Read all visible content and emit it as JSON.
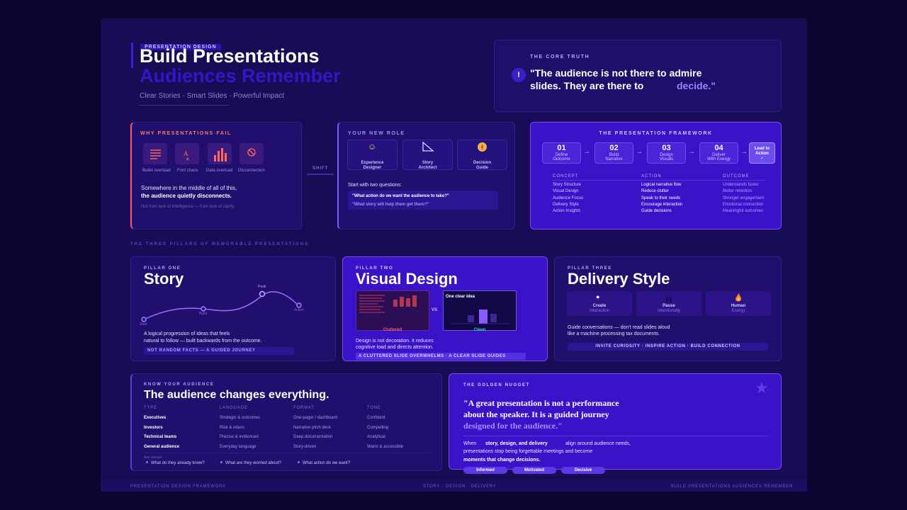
{
  "header": {
    "eyebrow": "PRESENTATION DESIGN",
    "title": "Build Presentations",
    "title_2": "Audiences Remember",
    "subtitle": "Clear Stories · Smart Slides · Powerful Impact"
  },
  "core_truth": {
    "label": "THE CORE TRUTH",
    "icon": "exclamation-icon",
    "quote_1": "\"The audience is not there to admire",
    "quote_2": "slides. They are there to",
    "quote_highlight": "decide.\""
  },
  "why_fail": {
    "label": "WHY PRESENTATIONS FAIL",
    "items": [
      {
        "icon": "bullet-list-icon",
        "label": "Bullet overload"
      },
      {
        "icon": "font-chaos-icon",
        "label": "Font chaos"
      },
      {
        "icon": "bar-chart-icon",
        "label": "Data overload"
      },
      {
        "icon": "ban-icon",
        "label": "Disconnection"
      }
    ],
    "text_1": "Somewhere in the middle of all of this,",
    "text_2": "the audience quietly disconnects.",
    "footnote": "Not from lack of intelligence — from lack of clarity."
  },
  "shift": {
    "label": "SHIFT"
  },
  "new_role": {
    "label": "YOUR NEW ROLE",
    "roles": [
      {
        "icon": "theater-masks-icon",
        "line1": "Experience",
        "line2": "Designer"
      },
      {
        "icon": "set-square-icon",
        "line1": "Story",
        "line2": "Architect"
      },
      {
        "icon": "compass-icon",
        "line1": "Decision",
        "line2": "Guide"
      }
    ],
    "prompt": "Start with two questions:",
    "q1": "\"What action do we want the audience to take?\"",
    "q2": "\"What story will help them get there?\""
  },
  "framework": {
    "label": "THE PRESENTATION FRAMEWORK",
    "steps": [
      {
        "num": "01",
        "line1": "Define",
        "line2": "Outcome"
      },
      {
        "num": "02",
        "line1": "Build",
        "line2": "Narrative"
      },
      {
        "num": "03",
        "line1": "Design",
        "line2": "Visuals"
      },
      {
        "num": "04",
        "line1": "Deliver",
        "line2": "With Energy"
      }
    ],
    "final_1": "Lead to",
    "final_2": "Action",
    "columns": {
      "concept": "CONCEPT",
      "action": "ACTION",
      "outcome": "OUTCOME"
    },
    "concept_items": [
      "Story Structure",
      "Visual Design",
      "Audience Focus",
      "Delivery Style",
      "Action Insights"
    ],
    "action_items": [
      "Logical narrative flow",
      "Reduce clutter",
      "Speak to their needs",
      "Encourage interaction",
      "Guide decisions"
    ],
    "outcome_items": [
      "Understands faster",
      "Better retention",
      "Stronger engagement",
      "Emotional connection",
      "Meaningful outcomes"
    ]
  },
  "pillars_heading": "THE THREE PILLARS OF MEMORABLE PRESENTATIONS",
  "pillar_story": {
    "eyebrow": "PILLAR ONE",
    "title": "Story",
    "points": [
      "Start",
      "Build",
      "Peak",
      "Action"
    ],
    "text_1": "A logical progression of ideas that feels",
    "text_2": "natural to follow — built backwards from the outcome.",
    "tag": "NOT RANDOM FACTS — A GUIDED JOURNEY"
  },
  "pillar_visual": {
    "eyebrow": "PILLAR TWO",
    "title": "Visual Design",
    "cluttered": "Cluttered",
    "vs": "VS",
    "clear_title": "One clear idea",
    "clean": "Clean",
    "text_1": "Design is not decoration. It reduces",
    "text_2": "cognitive load and directs attention.",
    "tag": "A CLUTTERED SLIDE OVERWHELMS · A CLEAR SLIDE GUIDES"
  },
  "pillar_delivery": {
    "eyebrow": "PILLAR THREE",
    "title": "Delivery Style",
    "cards": [
      {
        "icon": "speech-bubble-icon",
        "line1": "Create",
        "line2": "Interaction"
      },
      {
        "icon": "pause-icon",
        "line1": "Pause",
        "line2": "Intentionally"
      },
      {
        "icon": "fire-icon",
        "line1": "Human",
        "line2": "Energy"
      }
    ],
    "text_1": "Guide conversations — don't read slides aloud",
    "text_2": "like a machine processing tax documents.",
    "tag": "INVITE CURIOSITY · INSPIRE ACTION · BUILD CONNECTION"
  },
  "audience": {
    "eyebrow": "KNOW YOUR AUDIENCE",
    "title": "The audience changes everything.",
    "headers": [
      "TYPE",
      "LANGUAGE",
      "FORMAT",
      "TONE"
    ],
    "rows": [
      [
        "Executives",
        "Strategic & outcomes",
        "One-pager / dashboard",
        "Confident"
      ],
      [
        "Investors",
        "Risk & return",
        "Narrative pitch deck",
        "Compelling"
      ],
      [
        "Technical teams",
        "Precise & evidenced",
        "Deep documentation",
        "Analytical"
      ],
      [
        "General audience",
        "Everyday language",
        "Story-driven",
        "Warm & accessible"
      ]
    ],
    "ask": "Ask always:",
    "questions": [
      "What do they already know?",
      "What are they worried about?",
      "What action do we want?"
    ]
  },
  "nugget": {
    "label": "THE GOLDEN NUGGET",
    "quote_1": "\"A great presentation is not a performance",
    "quote_2": "about the speaker. It is a guided journey",
    "quote_3": "designed for the audience.\"",
    "body_1a": "When",
    "body_1b": "story, design, and delivery",
    "body_1c": "align around audience needs,",
    "body_2": "presentations stop being forgettable meetings and become",
    "body_3": "moments that change decisions.",
    "chips": [
      "Informed",
      "Motivated",
      "Decisive"
    ]
  },
  "footer": {
    "left": "PRESENTATION DESIGN FRAMEWORK",
    "center": "STORY · DESIGN · DELIVERY",
    "right": "BUILD PRESENTATIONS AUDIENCES REMEMBER"
  }
}
